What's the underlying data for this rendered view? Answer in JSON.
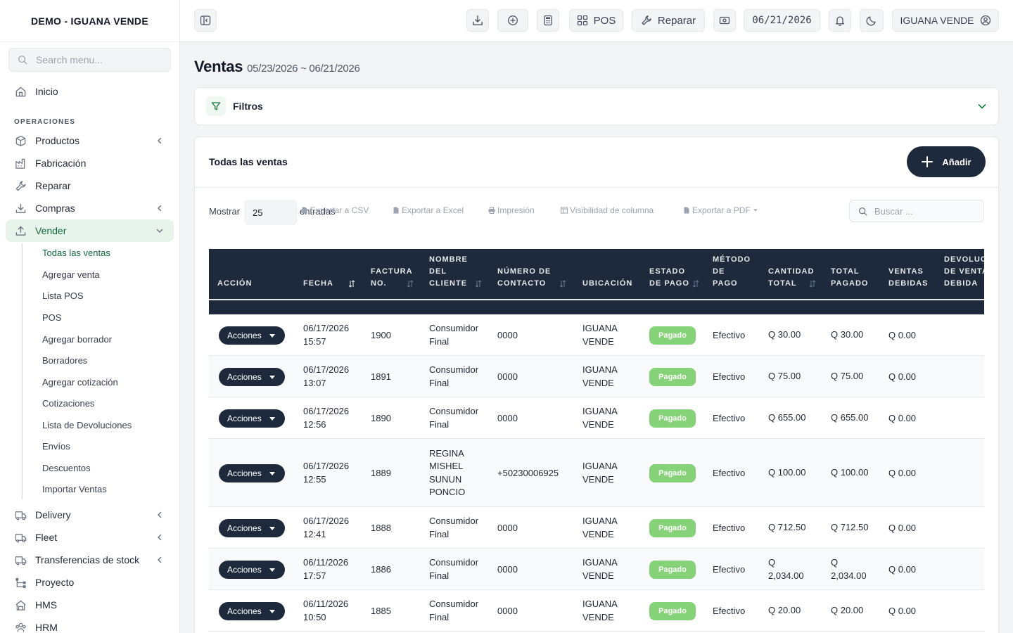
{
  "sidebar": {
    "brand": "DEMO - IGUANA VENDE",
    "search_placeholder": "Search menu...",
    "home": "Inicio",
    "section_label": "OPERACIONES",
    "items": [
      {
        "label": "Productos"
      },
      {
        "label": "Fabricación"
      },
      {
        "label": "Reparar"
      },
      {
        "label": "Compras"
      },
      {
        "label": "Vender"
      },
      {
        "label": "Delivery"
      },
      {
        "label": "Fleet"
      },
      {
        "label": "Transferencias de stock"
      },
      {
        "label": "Proyecto"
      },
      {
        "label": "HMS"
      },
      {
        "label": "HRM"
      }
    ],
    "sell_submenu": [
      "Todas las ventas",
      "Agregar venta",
      "Lista POS",
      "POS",
      "Agregar borrador",
      "Borradores",
      "Agregar cotización",
      "Cotizaciones",
      "Lista de Devoluciones",
      "Envíos",
      "Descuentos",
      "Importar Ventas"
    ]
  },
  "topbar": {
    "pos_label": "POS",
    "repair_label": "Reparar",
    "date": "06/21/2026",
    "user_label": "IGUANA VENDE"
  },
  "page": {
    "title": "Ventas",
    "date_range": "05/23/2026 ~ 06/21/2026"
  },
  "filters": {
    "label": "Filtros"
  },
  "list": {
    "title": "Todas las ventas",
    "add_label": "Añadir",
    "show_label": "Mostrar",
    "page_size": "25",
    "entries_label": "entradas",
    "exports": {
      "csv": "Exportar a CSV",
      "excel": "Exportar a Excel",
      "print": "Impresión",
      "columns": "Visibilidad de columna",
      "pdf": "Exportar a PDF"
    },
    "search_placeholder": "Buscar ...",
    "headers": {
      "action": "ACCIÓN",
      "date": "FECHA",
      "invoice": [
        "FACTURA",
        "NO."
      ],
      "customer": [
        "NOMBRE",
        "DEL",
        "CLIENTE"
      ],
      "contact": [
        "NÚMERO DE",
        "CONTACTO"
      ],
      "location": "UBICACIÓN",
      "pay_status": [
        "ESTADO",
        "DE PAGO"
      ],
      "pay_method": [
        "MÉTODO",
        "DE",
        "PAGO"
      ],
      "total": [
        "CANTIDAD",
        "TOTAL"
      ],
      "paid": [
        "TOTAL",
        "PAGADO"
      ],
      "due": [
        "VENTAS",
        "DEBIDAS"
      ],
      "return_due": [
        "DEVOLUCIÓN",
        "DE VENTA",
        "DEBIDA"
      ]
    },
    "action_label": "Acciones",
    "rows": [
      {
        "date": [
          "06/17/2026",
          "15:57"
        ],
        "invoice": "1900",
        "customer": [
          "Consumidor",
          "Final"
        ],
        "contact": "0000",
        "location": [
          "IGUANA",
          "VENDE"
        ],
        "status": "Pagado",
        "method": "Efectivo",
        "total": [
          "Q 30.00"
        ],
        "paid": [
          "Q 30.00"
        ],
        "due": "Q 0.00"
      },
      {
        "date": [
          "06/17/2026",
          "13:07"
        ],
        "invoice": "1891",
        "customer": [
          "Consumidor",
          "Final"
        ],
        "contact": "0000",
        "location": [
          "IGUANA",
          "VENDE"
        ],
        "status": "Pagado",
        "method": "Efectivo",
        "total": [
          "Q 75.00"
        ],
        "paid": [
          "Q 75.00"
        ],
        "due": "Q 0.00"
      },
      {
        "date": [
          "06/17/2026",
          "12:56"
        ],
        "invoice": "1890",
        "customer": [
          "Consumidor",
          "Final"
        ],
        "contact": "0000",
        "location": [
          "IGUANA",
          "VENDE"
        ],
        "status": "Pagado",
        "method": "Efectivo",
        "total": [
          "Q 655.00"
        ],
        "paid": [
          "Q 655.00"
        ],
        "due": "Q 0.00"
      },
      {
        "date": [
          "06/17/2026",
          "12:55"
        ],
        "invoice": "1889",
        "customer": [
          "REGINA",
          "MISHEL",
          "SUNUN",
          "PONCIO"
        ],
        "contact": "+50230006925",
        "location": [
          "IGUANA",
          "VENDE"
        ],
        "status": "Pagado",
        "method": "Efectivo",
        "total": [
          "Q 100.00"
        ],
        "paid": [
          "Q 100.00"
        ],
        "due": "Q 0.00"
      },
      {
        "date": [
          "06/17/2026",
          "12:41"
        ],
        "invoice": "1888",
        "customer": [
          "Consumidor",
          "Final"
        ],
        "contact": "0000",
        "location": [
          "IGUANA",
          "VENDE"
        ],
        "status": "Pagado",
        "method": "Efectivo",
        "total": [
          "Q 712.50"
        ],
        "paid": [
          "Q 712.50"
        ],
        "due": "Q 0.00"
      },
      {
        "date": [
          "06/11/2026",
          "17:57"
        ],
        "invoice": "1886",
        "customer": [
          "Consumidor",
          "Final"
        ],
        "contact": "0000",
        "location": [
          "IGUANA",
          "VENDE"
        ],
        "status": "Pagado",
        "method": "Efectivo",
        "total": [
          "Q",
          "2,034.00"
        ],
        "paid": [
          "Q",
          "2,034.00"
        ],
        "due": "Q 0.00"
      },
      {
        "date": [
          "06/11/2026",
          "10:50"
        ],
        "invoice": "1885",
        "customer": [
          "Consumidor",
          "Final"
        ],
        "contact": "0000",
        "location": [
          "IGUANA",
          "VENDE"
        ],
        "status": "Pagado",
        "method": "Efectivo",
        "total": [
          "Q 20.00"
        ],
        "paid": [
          "Q 20.00"
        ],
        "due": "Q 0.00"
      }
    ]
  }
}
